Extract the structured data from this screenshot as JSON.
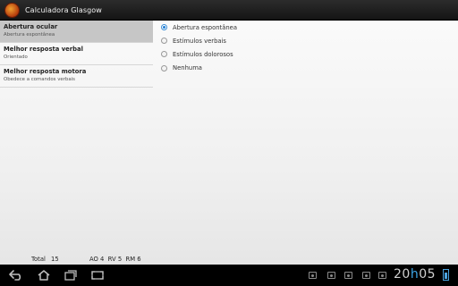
{
  "app": {
    "title": "Calculadora Glasgow"
  },
  "categories": [
    {
      "title": "Abertura ocular",
      "subtitle": "Abertura espontânea",
      "selected": true
    },
    {
      "title": "Melhor resposta verbal",
      "subtitle": "Orientado",
      "selected": false
    },
    {
      "title": "Melhor resposta motora",
      "subtitle": "Obedece a comandos verbais",
      "selected": false
    }
  ],
  "options": [
    {
      "label": "Abertura espontânea",
      "checked": true
    },
    {
      "label": "Estímulos verbais",
      "checked": false
    },
    {
      "label": "Estímulos dolorosos",
      "checked": false
    },
    {
      "label": "Nenhuma",
      "checked": false
    }
  ],
  "footer": {
    "total_label": "Total",
    "total_value": "15",
    "breakdown": "AO 4  RV 5  RM 6"
  },
  "system_bar": {
    "clock_hours": "20",
    "clock_sep": "h",
    "clock_minutes": "05",
    "accent_color": "#3da6e8",
    "icons": [
      "back-icon",
      "home-icon",
      "recent-apps-icon",
      "screenshot-icon",
      "notification-icon",
      "battery-icon"
    ]
  }
}
